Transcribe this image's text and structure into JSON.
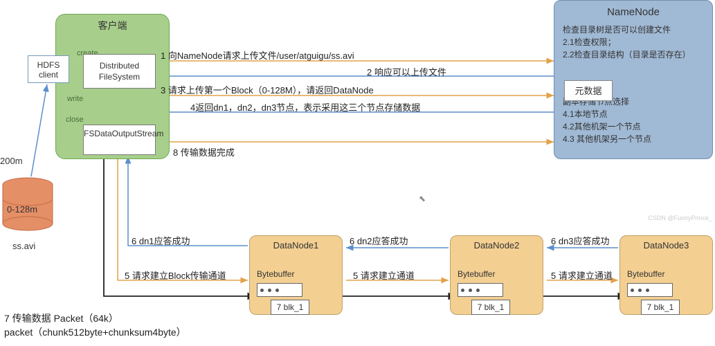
{
  "client": {
    "title": "客户端",
    "hdfs_client": "HDFS client",
    "dfs": "Distributed FileSystem",
    "fsout": "FSDataOutputStream",
    "label_create": "create",
    "label_write": "write",
    "label_close": "close"
  },
  "namenode": {
    "title": "NameNode",
    "line1": "检查目录树是否可以创建文件",
    "line2": "2.1检查权限；",
    "line3": "2.2检查目录结构（目录是否存在）",
    "meta": "元数据",
    "rep_title": "副本存储节点选择",
    "rep1": "4.1本地节点",
    "rep2": "4.2其他机架一个节点",
    "rep3": "4.3 其他机架另一个节点"
  },
  "file": {
    "top": "200m",
    "range": "0-128m",
    "name": "ss.avi"
  },
  "datanodes": {
    "dn1": "DataNode1",
    "dn2": "DataNode2",
    "dn3": "DataNode3",
    "bytebuffer": "Bytebuffer",
    "blk": "7 blk_1"
  },
  "steps": {
    "s1": "1 向NameNode请求上传文件/user/atguigu/ss.avi",
    "s2": "2 响应可以上传文件",
    "s3": "3 请求上传第一个Block（0-128M），请返回DataNode",
    "s4": "4返回dn1，dn2，dn3节点，表示采用这三个节点存储数据",
    "s8": "8 传输数据完成",
    "s5a": "5 请求建立Block传输通道",
    "s5b": "5 请求建立通道",
    "s5c": "5 请求建立通道",
    "s6a": "6 dn1应答成功",
    "s6b": "6 dn2应答成功",
    "s6c": "6 dn3应答成功",
    "s7": "7 传输数据  Packet（64k）",
    "s7b": "packet（chunk512byte+chunksum4byte）"
  },
  "watermark": "CSDN @FunnyPrince_"
}
